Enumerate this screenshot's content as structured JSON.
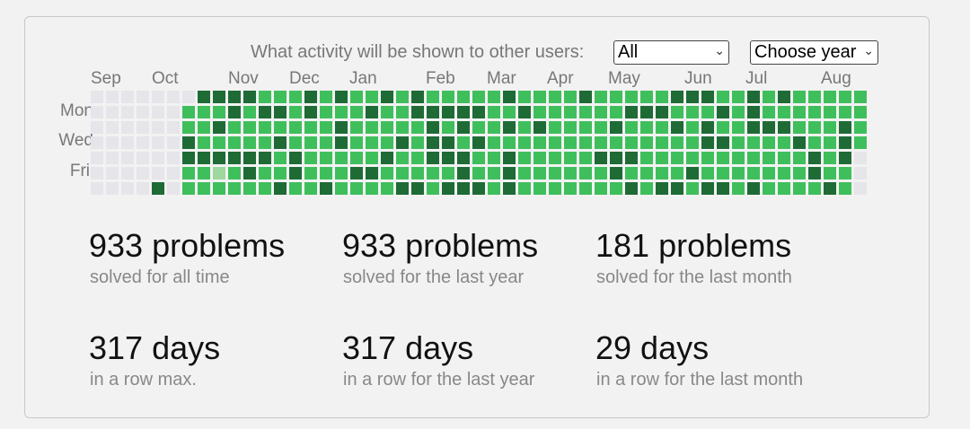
{
  "filter": {
    "question": "What activity will be shown to other users:",
    "activity_value": "All",
    "year_value": "Choose year"
  },
  "heatmap": {
    "months": [
      "Sep",
      "Oct",
      "Nov",
      "Dec",
      "Jan",
      "Feb",
      "Mar",
      "Apr",
      "May",
      "Jun",
      "Jul",
      "Aug"
    ],
    "day_labels": [
      "Mon",
      "Wed",
      "Fri"
    ],
    "colors": {
      "empty": "#e5e5ea",
      "low": "#9ed89e",
      "mid": "#3fbf5c",
      "high": "#1e6b36"
    },
    "weeks": 51,
    "empty_weeks": 6,
    "partial_last_week_days": 4,
    "intensity_note_levels": [
      "empty",
      "low",
      "mid",
      "high"
    ]
  },
  "stats": [
    {
      "value": "933 problems",
      "label": "solved for all time"
    },
    {
      "value": "933 problems",
      "label": "solved for the last year"
    },
    {
      "value": "181 problems",
      "label": "solved for the last month"
    },
    {
      "value": "317 days",
      "label": "in a row max."
    },
    {
      "value": "317 days",
      "label": "in a row for the last year"
    },
    {
      "value": "29 days",
      "label": "in a row for the last month"
    }
  ]
}
